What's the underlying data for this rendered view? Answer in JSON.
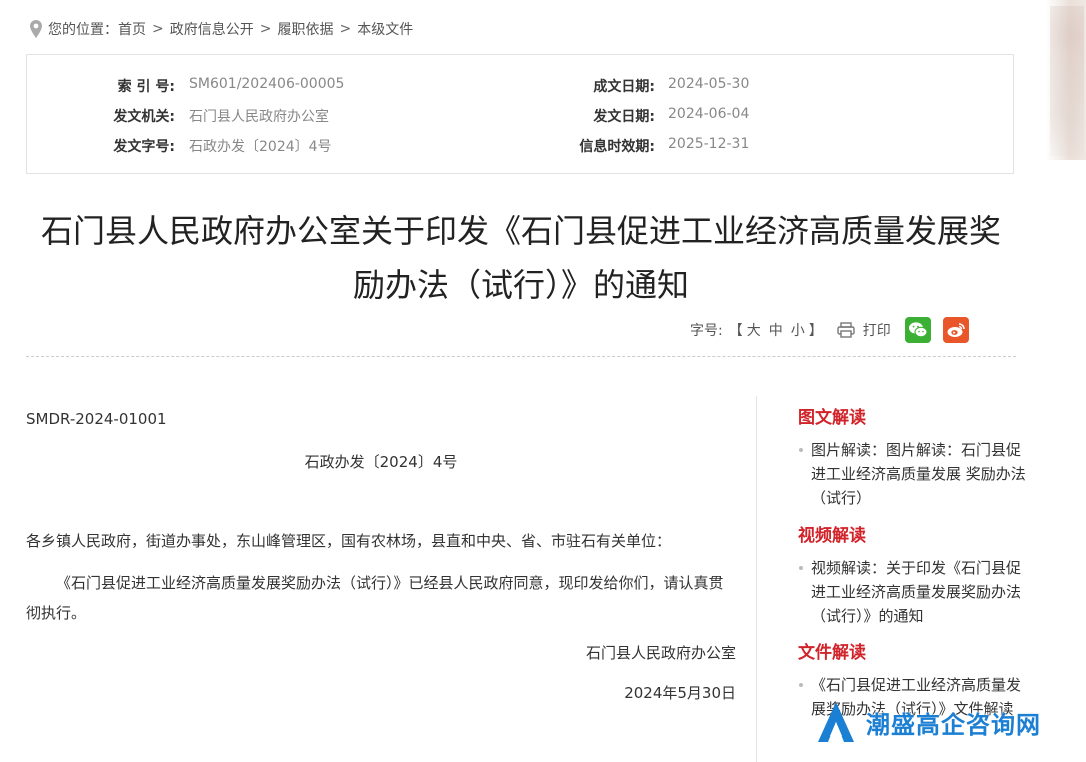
{
  "breadcrumb": {
    "prefix": "您的位置：",
    "items": [
      "首页",
      "政府信息公开",
      "履职依据",
      "本级文件"
    ],
    "separator": ">"
  },
  "info": {
    "index_label": "索 引 号:",
    "index_value": "SM601/202406-00005",
    "issuer_label": "发文机关:",
    "issuer_value": "石门县人民政府办公室",
    "doc_no_label": "发文字号:",
    "doc_no_value": "石政办发〔2024〕4号",
    "created_label": "成文日期:",
    "created_value": "2024-05-30",
    "published_label": "发文日期:",
    "published_value": "2024-06-04",
    "validity_label": "信息时效期:",
    "validity_value": "2025-12-31"
  },
  "title": "石门县人民政府办公室关于印发《石门县促进工业经济高质量发展奖励办法（试行）》的通知",
  "tools": {
    "font_size_label": "字号:",
    "bracket_open": "【",
    "large": "大",
    "medium": "中",
    "small": "小",
    "bracket_close": "】",
    "print": "打印",
    "wechat_color": "#3cb034",
    "weibo_color": "#e8562a"
  },
  "document": {
    "doc_code": "SMDR-2024-01001",
    "doc_ref": "石政办发〔2024〕4号",
    "addressee": "各乡镇人民政府，街道办事处，东山峰管理区，国有农林场，县直和中央、省、市驻石有关单位：",
    "paragraph": "《石门县促进工业经济高质量发展奖励办法（试行）》已经县人民政府同意，现印发给你们，请认真贯彻执行。",
    "signer": "石门县人民政府办公室",
    "sign_date": "2024年5月30日"
  },
  "sidebar": {
    "sections": [
      {
        "heading": "图文解读",
        "item": "图片解读：图片解读：石门县促进工业经济高质量发展 奖励办法（试行）"
      },
      {
        "heading": "视频解读",
        "item": "视频解读：关于印发《石门县促进工业经济高质量发展奖励办法（试行）》的通知"
      },
      {
        "heading": "文件解读",
        "item": "《石门县促进工业经济高质量发展奖励办法（试行）》文件解读"
      }
    ],
    "accent_color": "#d1232a"
  },
  "watermark": {
    "text": "潮盛高企咨询网",
    "color": "#1b7fd4"
  }
}
